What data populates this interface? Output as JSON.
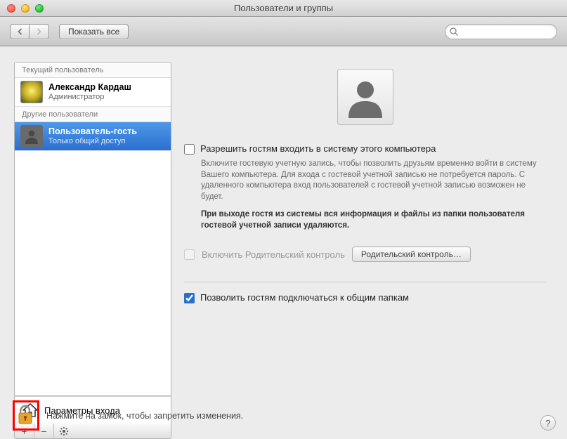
{
  "window": {
    "title": "Пользователи и группы"
  },
  "toolbar": {
    "show_all": "Показать все",
    "search_placeholder": ""
  },
  "sidebar": {
    "current_header": "Текущий пользователь",
    "other_header": "Другие пользователи",
    "current_user": {
      "name": "Александр Кардаш",
      "role": "Администратор"
    },
    "guest_user": {
      "name": "Пользователь-гость",
      "role": "Только общий доступ"
    },
    "login_options": "Параметры входа"
  },
  "main": {
    "allow_guest_label": "Разрешить гостям входить в систему этого компьютера",
    "allow_guest_desc": "Включите гостевую учетную запись, чтобы позволить друзьям временно войти в систему Вашего компьютера. Для входа с гостевой учетной записью не потребуется пароль. С удаленного компьютера вход пользователей с гостевой учетной записью возможен не будет.",
    "guest_logout_note": "При выходе гостя из системы вся информация и файлы из папки пользователя гостевой учетной записи удаляются.",
    "parental_check_label": "Включить Родительский контроль",
    "parental_button": "Родительский контроль…",
    "allow_shared_label": "Позволить гостям подключаться к общим папкам"
  },
  "footer": {
    "lock_text": "Нажмите на замок, чтобы запретить изменения."
  }
}
